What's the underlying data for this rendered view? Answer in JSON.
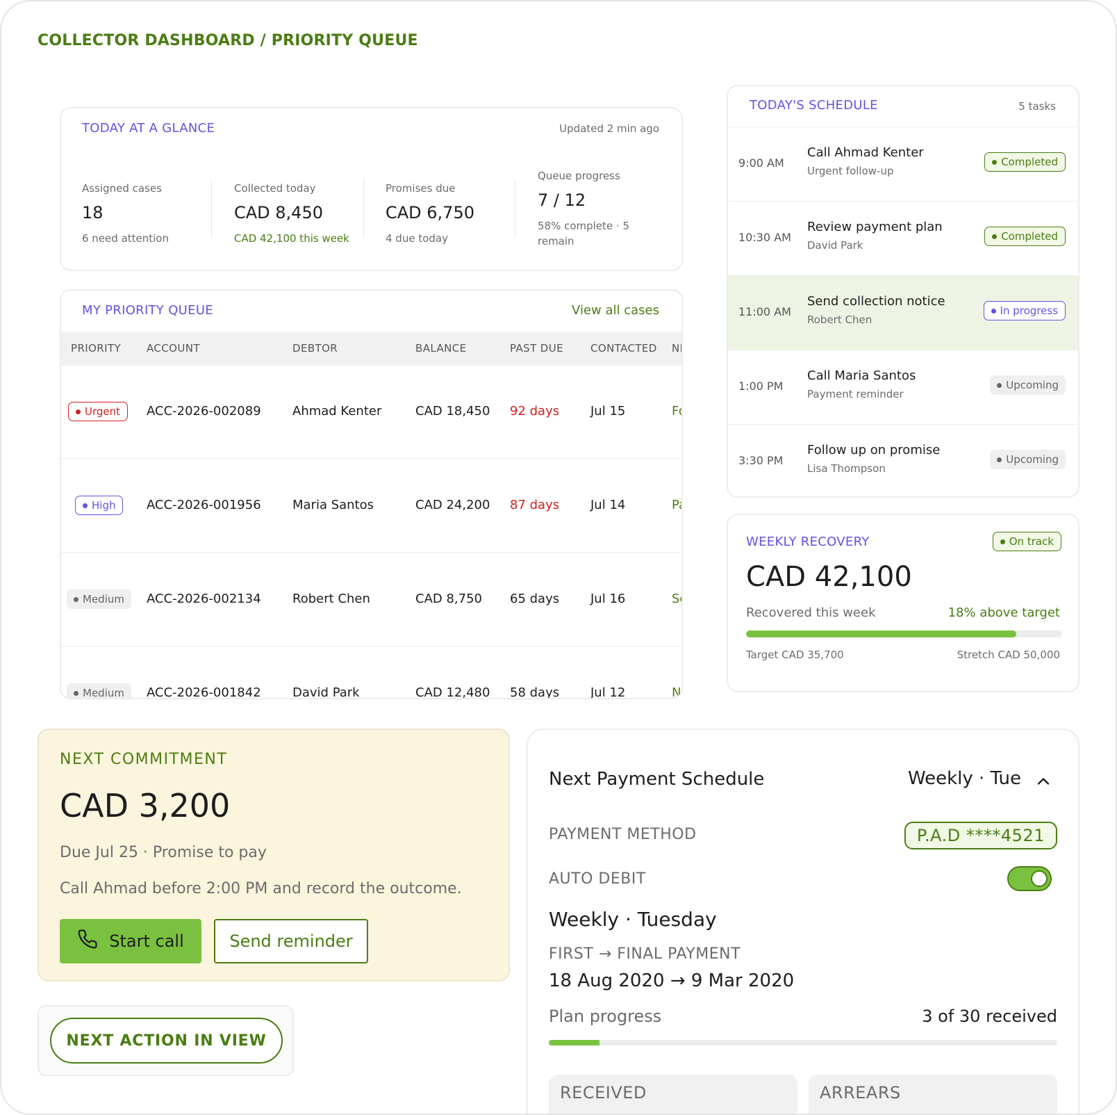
{
  "page": {
    "title": "COLLECTOR DASHBOARD / PRIORITY QUEUE"
  },
  "glance": {
    "title": "TODAY AT A GLANCE",
    "updated": "Updated 2 min ago",
    "stats": [
      {
        "label": "Assigned cases",
        "value": "18",
        "sub": "6 need attention"
      },
      {
        "label": "Collected today",
        "value": "CAD 8,450",
        "sub": "CAD 42,100 this week"
      },
      {
        "label": "Promises due",
        "value": "CAD 6,750",
        "sub": "4 due today"
      },
      {
        "label": "Queue progress",
        "value": "7 / 12",
        "sub": "58% complete · 5 remain"
      }
    ]
  },
  "queue": {
    "title": "MY PRIORITY QUEUE",
    "view_all": "View all cases",
    "columns": [
      "PRIORITY",
      "ACCOUNT",
      "DEBTOR",
      "BALANCE",
      "PAST DUE",
      "CONTACTED",
      "NEXT"
    ],
    "rows": [
      {
        "priority": "Urgent",
        "account": "ACC-2026-002089",
        "debtor": "Ahmad Kenter",
        "balance": "CAD 18,450",
        "past_due": "92 days",
        "contacted": "Jul 15",
        "next": "Follow up"
      },
      {
        "priority": "High",
        "account": "ACC-2026-001956",
        "debtor": "Maria Santos",
        "balance": "CAD 24,200",
        "past_due": "87 days",
        "contacted": "Jul 14",
        "next": "Payment plan"
      },
      {
        "priority": "Medium",
        "account": "ACC-2026-002134",
        "debtor": "Robert Chen",
        "balance": "CAD 8,750",
        "past_due": "65 days",
        "contacted": "Jul 16",
        "next": "Send notice"
      },
      {
        "priority": "Medium",
        "account": "ACC-2026-001842",
        "debtor": "David Park",
        "balance": "CAD 12,480",
        "past_due": "58 days",
        "contacted": "Jul 12",
        "next": "Negotiate"
      }
    ]
  },
  "schedule": {
    "title": "TODAY'S SCHEDULE",
    "count": "5 tasks",
    "items": [
      {
        "time": "9:00 AM",
        "title": "Call Ahmad Kenter",
        "who": "Urgent follow-up",
        "status": "Completed"
      },
      {
        "time": "10:30 AM",
        "title": "Review payment plan",
        "who": "David Park",
        "status": "Completed"
      },
      {
        "time": "11:00 AM",
        "title": "Send collection notice",
        "who": "Robert Chen",
        "status": "In progress"
      },
      {
        "time": "1:00 PM",
        "title": "Call Maria Santos",
        "who": "Payment reminder",
        "status": "Upcoming"
      },
      {
        "time": "3:30 PM",
        "title": "Follow up on promise",
        "who": "Lisa Thompson",
        "status": "Upcoming"
      }
    ]
  },
  "weekly": {
    "title": "WEEKLY RECOVERY",
    "badge": "On track",
    "amount": "CAD 42,100",
    "caption": "Recovered this week",
    "above": "18% above target",
    "progress_fraction": 0.855,
    "target": "Target CAD 35,700",
    "stretch": "Stretch CAD 50,000"
  },
  "commitment": {
    "title": "NEXT COMMITMENT",
    "amount": "CAD 3,200",
    "due": "Due Jul 25 · Promise to pay",
    "note": "Call Ahmad before 2:00 PM and record the outcome.",
    "start_call": "Start call",
    "send_reminder": "Send reminder"
  },
  "next_action": {
    "label": "NEXT ACTION IN VIEW"
  },
  "payment": {
    "title": "Next Payment Schedule",
    "frequency": "Weekly · Tue",
    "method_label": "PAYMENT METHOD",
    "method_value": "P.A.D ****4521",
    "auto_debit_label": "AUTO DEBIT",
    "auto_debit_on": true,
    "schedule_text": "Weekly · Tuesday",
    "dates_label": "FIRST → FINAL PAYMENT",
    "dates_value": "18 Aug 2020 → 9 Mar 2020",
    "plan_progress_label": "Plan progress",
    "plan_progress_value": "3 of 30 received",
    "plan_progress_fraction": 0.1,
    "received_label": "RECEIVED",
    "arrears_label": "ARREARS"
  },
  "colors": {
    "accent_green": "#4a7d12",
    "bright_green": "#7ac13f",
    "purple": "#6a4fe0",
    "red": "#d32020",
    "cream": "#fcf5dd"
  }
}
